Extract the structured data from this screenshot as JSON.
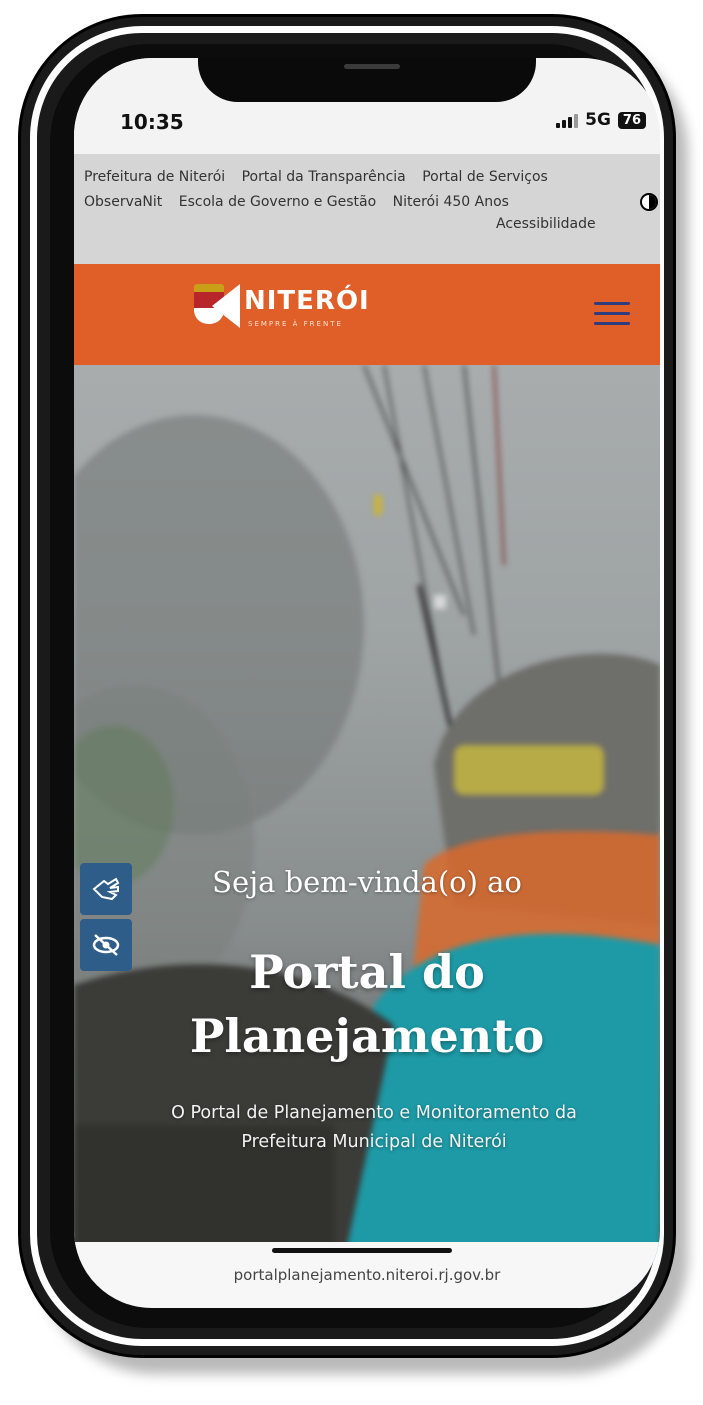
{
  "status_bar": {
    "time": "10:35",
    "network": "5G",
    "battery": "76"
  },
  "top_nav": {
    "row1": [
      "Prefeitura de Niterói",
      "Portal da Transparência",
      "Portal de Serviços"
    ],
    "row2": [
      "ObservaNit",
      "Escola de Governo e Gestão",
      "Niterói 450 Anos"
    ],
    "accessibility_label": "Acessibilidade"
  },
  "header": {
    "logo_text": "NITERÓI",
    "logo_tagline": "SEMPRE À FRENTE",
    "accent_color": "#e05f28",
    "menu_icon": "hamburger-icon"
  },
  "hero": {
    "welcome": "Seja bem-vinda(o) ao",
    "title_line1": "Portal do",
    "title_line2": "Planejamento",
    "subtitle_line1": "O Portal de Planejamento e Monitoramento da",
    "subtitle_line2": "Prefeitura Municipal de Niterói",
    "side_buttons": [
      "sign-language-icon",
      "hide-eye-icon"
    ]
  },
  "browser": {
    "url": "portalplanejamento.niteroi.rj.gov.br"
  }
}
